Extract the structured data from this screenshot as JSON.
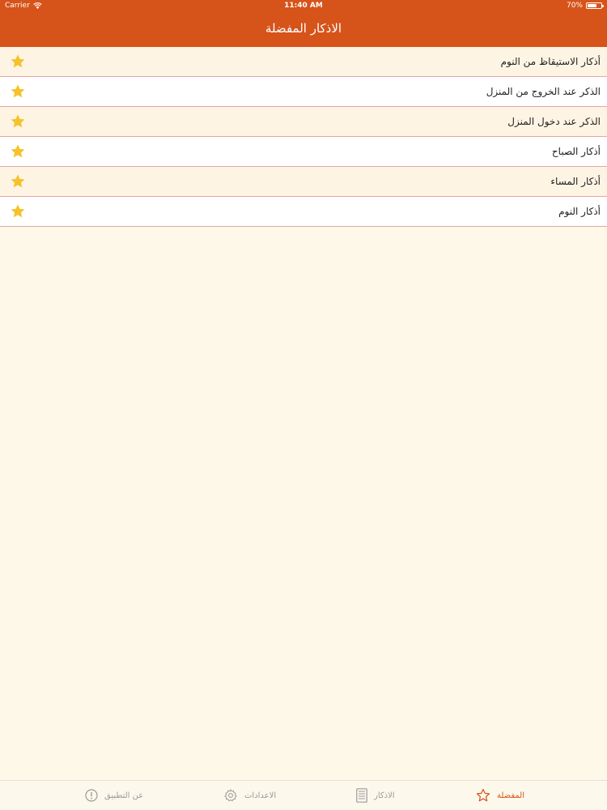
{
  "status_bar": {
    "carrier": "Carrier",
    "time": "11:40 AM",
    "battery_text": "70%",
    "battery_level": 0.7
  },
  "nav": {
    "title": "الاذكار المفضلة"
  },
  "list": {
    "items": [
      {
        "title": "أذكار الاستيقاظ من النوم",
        "favorite": true
      },
      {
        "title": "الذكر عند الخروج من المنزل",
        "favorite": true
      },
      {
        "title": "الذكر عند دخول المنزل",
        "favorite": true
      },
      {
        "title": "أذكار الصباح",
        "favorite": true
      },
      {
        "title": "أذكار المساء",
        "favorite": true
      },
      {
        "title": "أذكار النوم",
        "favorite": true
      }
    ],
    "star_icon": "star-filled-icon"
  },
  "tabbar": {
    "tabs": [
      {
        "label": "المفضلة",
        "icon": "star-outline-icon",
        "active": true
      },
      {
        "label": "الاذكار",
        "icon": "list-icon",
        "active": false
      },
      {
        "label": "الاعدادات",
        "icon": "gear-icon",
        "active": false
      },
      {
        "label": "عن التطبيق",
        "icon": "info-icon",
        "active": false
      }
    ]
  },
  "colors": {
    "accent": "#d6531a",
    "background": "#fef8e9",
    "row_alt": "#fdf4e4",
    "row_divider": "#e9a3a0",
    "star": "#f5c22b",
    "tab_inactive": "#9a9a9a"
  }
}
